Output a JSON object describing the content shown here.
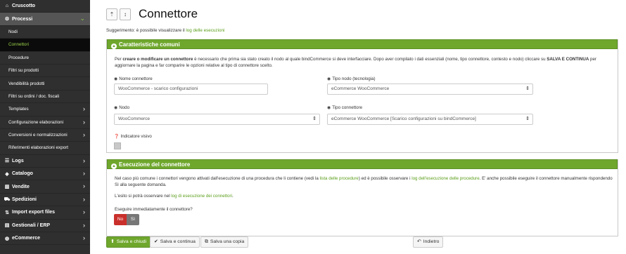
{
  "sidebar": {
    "items": [
      {
        "label": "Cruscotto",
        "icon": "home-icon",
        "glyph": "⌂",
        "chevron": ""
      },
      {
        "label": "Processi",
        "icon": "cogs-icon",
        "glyph": "⚙",
        "chevron": "⌄"
      },
      {
        "label": "Nodi",
        "sub": true
      },
      {
        "label": "Connettori",
        "sub": true
      },
      {
        "label": "Procedure",
        "sub": true
      },
      {
        "label": "Filtri su prodotti",
        "sub": true
      },
      {
        "label": "Vendibilità prodotti",
        "sub": true
      },
      {
        "label": "Filtri su ordini / doc. fiscali",
        "sub": true
      },
      {
        "label": "Templates",
        "sub": true,
        "chevron": "›"
      },
      {
        "label": "Configurazione elaborazioni",
        "sub": true,
        "chevron": "›"
      },
      {
        "label": "Conversioni e normalizzazioni",
        "sub": true,
        "chevron": "›"
      },
      {
        "label": "Riferimenti elaborazioni export",
        "sub": true
      },
      {
        "label": "Logs",
        "icon": "list-icon",
        "glyph": "☰",
        "chevron": "›"
      },
      {
        "label": "Catalogo",
        "icon": "tag-icon",
        "glyph": "◈",
        "chevron": "›"
      },
      {
        "label": "Vendite",
        "icon": "chart-icon",
        "glyph": "▥",
        "chevron": "›"
      },
      {
        "label": "Spedizioni",
        "icon": "truck-icon",
        "glyph": "⛟",
        "chevron": "›"
      },
      {
        "label": "Import export files",
        "icon": "upload-icon",
        "glyph": "⇅",
        "chevron": "›"
      },
      {
        "label": "Gestionali / ERP",
        "icon": "database-icon",
        "glyph": "▤",
        "chevron": "›"
      },
      {
        "label": "eCommerce",
        "icon": "globe-icon",
        "glyph": "◍",
        "chevron": "›"
      }
    ]
  },
  "header": {
    "title": "Connettore",
    "sort_up": "⇡",
    "sort_down": "↕",
    "hint_prefix": "Suggerimento: è possibile visualizzare il ",
    "hint_link": "log delle esecuzioni"
  },
  "panel1": {
    "title": "Caratteristiche comuni",
    "desc_1": "Per ",
    "desc_bold1": "creare o modificare un connettore",
    "desc_2": " è necessario che prima sia stato creato il nodo al quale bindCommerce si deve interfacciare. Dopo aver compilato i dati essenziali (nome, tipo connettore, contesto e nodo) cliccare su ",
    "desc_bold2": "SALVA E CONTINUA",
    "desc_3": " per aggiornare la pagina e far comparire le opzioni relative al tipo di connettore scelto.",
    "fields": {
      "nome_label": "Nome connettore",
      "nome_value": "WooCommerce - scarico configurazioni",
      "tipo_nodo_label": "Tipo nodo (tecnologia)",
      "tipo_nodo_value": "eCommerce WooCommerce",
      "nodo_label": "Nodo",
      "nodo_value": "WooCommerce",
      "tipo_conn_label": "Tipo connettore",
      "tipo_conn_value": "eCommerce WooCommerce [Scarico configurazioni su bindCommerce]",
      "indicatore_label": "Indicatore visivo"
    }
  },
  "panel2": {
    "title": "Esecuzione del connettore",
    "p1_a": "Nel caso più comune i connettori vengono attivati dall'esecuzione di una procedura che li contiene (vedi la ",
    "p1_link1": "lista delle procedure",
    "p1_b": ") ed è possibile osservare i ",
    "p1_link2": "log dell'esecuzione delle procedure",
    "p1_c": ". E' anche possibile eseguire il connettore manualmente rispondendo Sì alla seguente domanda.",
    "p2_a": "L'esito si potrà osservare nel ",
    "p2_link": "log di esecuzione dei connettori",
    "p2_b": ".",
    "question": "Eseguire immediatamente il connettore?",
    "no": "No",
    "si": "Sì"
  },
  "footer": {
    "save_close": "Salva e chiudi",
    "save_continue": "Salva e continua",
    "save_copy": "Salva una copia",
    "back": "Indietro"
  },
  "colors": {
    "accent": "#6fa72d",
    "sidebar": "#2f2f2f",
    "danger": "#c9302c"
  }
}
